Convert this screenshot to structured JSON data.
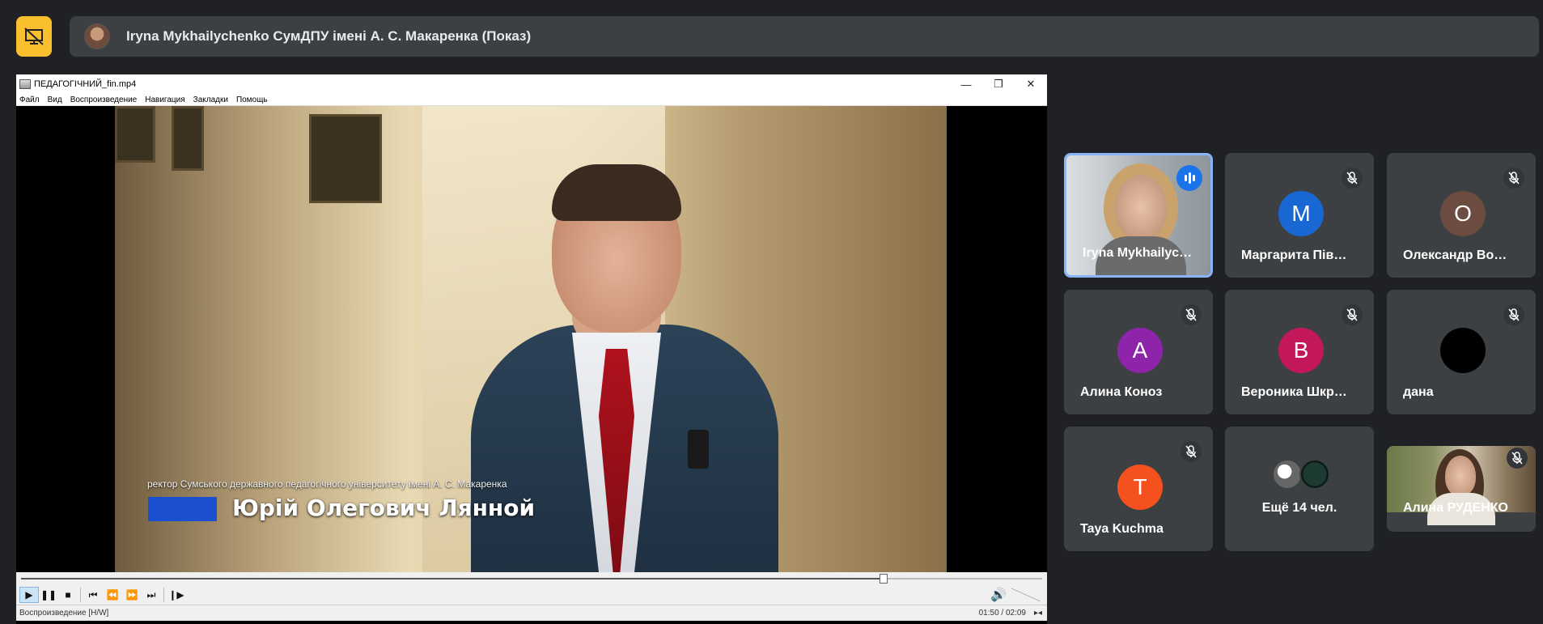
{
  "meet": {
    "presentation_title": "Iryna Mykhailychenko СумДПУ імені А. С. Макаренка (Показ)",
    "stop_presenting_icon": "presentation-off-icon"
  },
  "player": {
    "window_title": "ПЕДАГОГІЧНИЙ_fin.mp4",
    "window_controls": [
      "—",
      "❐",
      "✕"
    ],
    "menu": [
      "Файл",
      "Вид",
      "Воспроизведение",
      "Навигация",
      "Закладки",
      "Помощь"
    ],
    "video": {
      "lower_third_subtitle": "ректор Сумського державного педагогічного університету імені А. С. Макаренка",
      "lower_third_name": "Юрій Олегович Лянной"
    },
    "seek_progress": 0.845,
    "controls": [
      "play-icon",
      "pause-icon",
      "stop-icon",
      "skip-back-icon",
      "rewind-icon",
      "fast-forward-icon",
      "skip-forward-icon",
      "frame-step-icon"
    ],
    "status_text": "Воспроизведение [H/W]",
    "time": "01:50 / 02:09"
  },
  "participants": [
    {
      "name": "Iryna Mykhailyc…",
      "type": "video",
      "speaking": true
    },
    {
      "name": "Маргарита Пів…",
      "initial": "М",
      "color": "#1967d2",
      "muted": true
    },
    {
      "name": "Олександр Во…",
      "initial": "О",
      "color": "#6d4c41",
      "muted": true
    },
    {
      "name": "Алина Коноз",
      "initial": "А",
      "color": "#8e24aa",
      "muted": true
    },
    {
      "name": "Вероника Шкр…",
      "initial": "В",
      "color": "#c2185b",
      "muted": true
    },
    {
      "name": "дана",
      "initial": "",
      "color": "#000000",
      "muted": true
    },
    {
      "name": "Taya Kuchma",
      "initial": "T",
      "color": "#f4511e",
      "muted": true
    },
    {
      "name": "Ещё 14 чел.",
      "type": "more"
    },
    {
      "name": "Алина РУДЕНКО",
      "type": "video",
      "muted": true
    }
  ]
}
